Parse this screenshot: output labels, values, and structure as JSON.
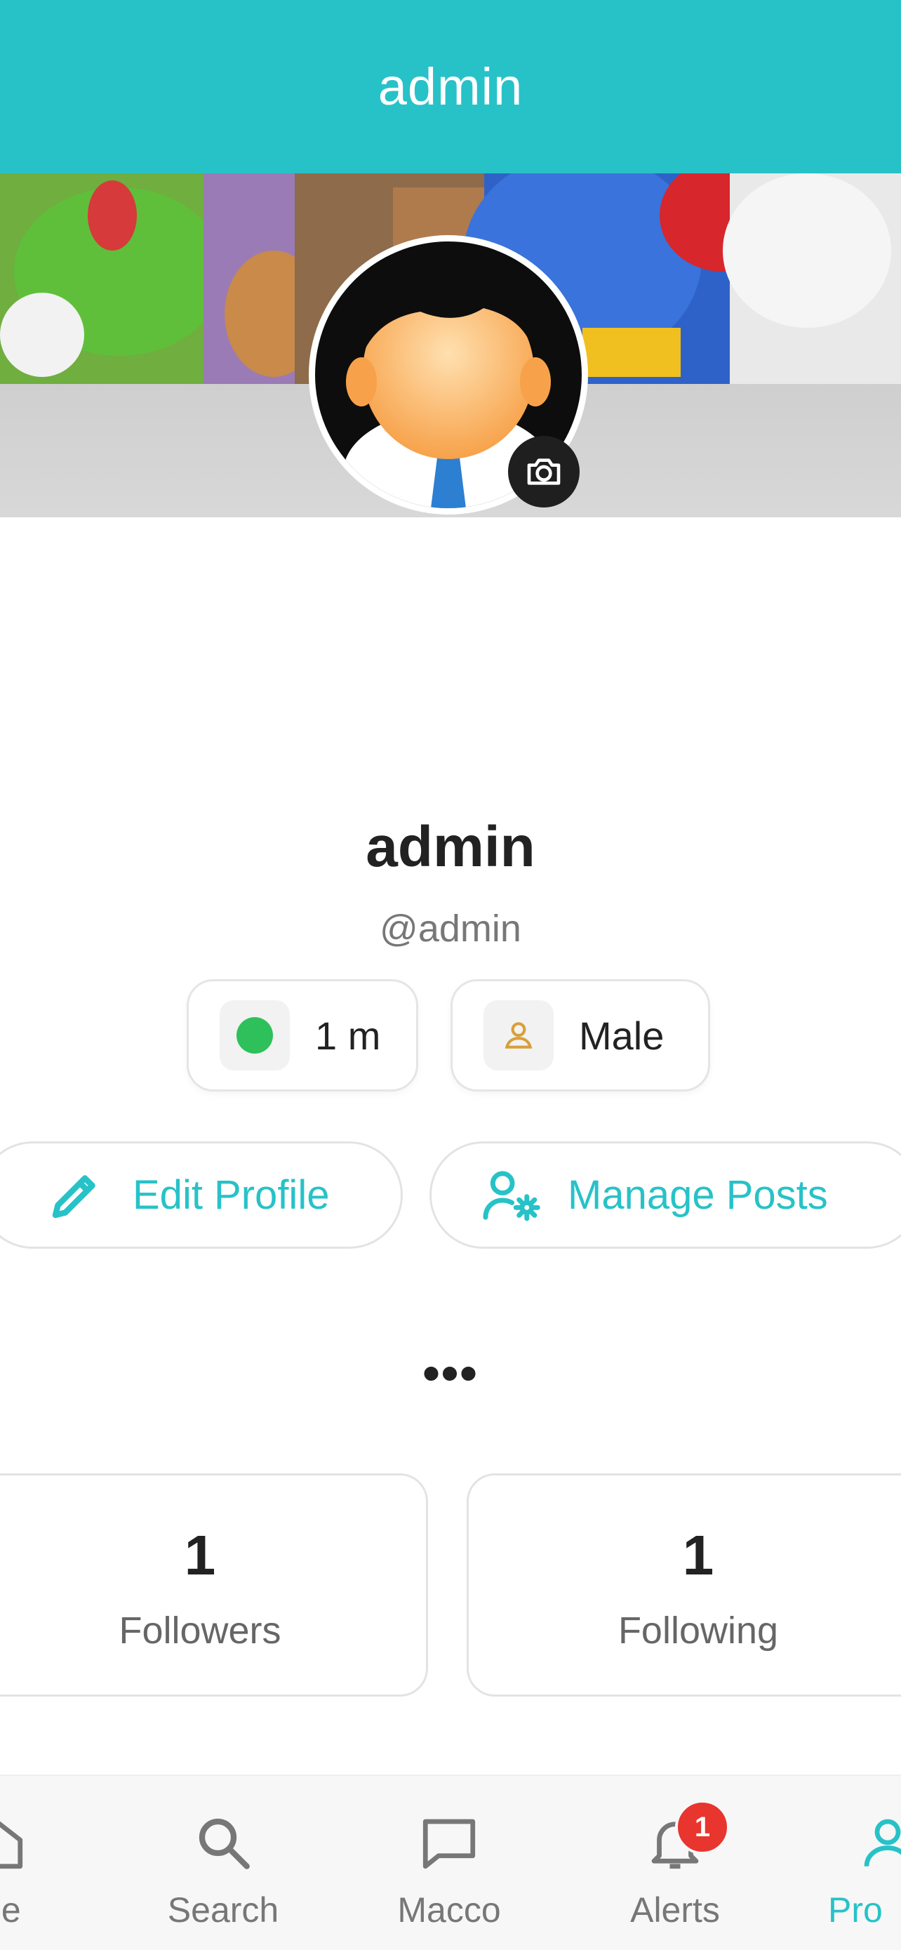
{
  "header": {
    "title": "admin"
  },
  "profile": {
    "display_name": "admin",
    "username": "@admin",
    "online_label": "1 m",
    "gender_label": "Male"
  },
  "actions": {
    "edit_label": "Edit Profile",
    "manage_label": "Manage Posts"
  },
  "more": {
    "label": "•••"
  },
  "stats": {
    "followers": {
      "value": "1",
      "label": "Followers"
    },
    "following": {
      "value": "1",
      "label": "Following"
    }
  },
  "tabbar": {
    "items": [
      {
        "label": "me",
        "icon": "home-icon"
      },
      {
        "label": "Search",
        "icon": "search-icon"
      },
      {
        "label": "Macco",
        "icon": "chat-bubble-icon"
      },
      {
        "label": "Alerts",
        "icon": "bell-icon",
        "badge": "1"
      },
      {
        "label": "Pro",
        "icon": "profile-icon",
        "active": true
      }
    ]
  },
  "colors": {
    "accent": "#27c2c8",
    "online": "#2ec05b",
    "badge": "#e8352e",
    "gender_icon": "#d8a03a"
  }
}
